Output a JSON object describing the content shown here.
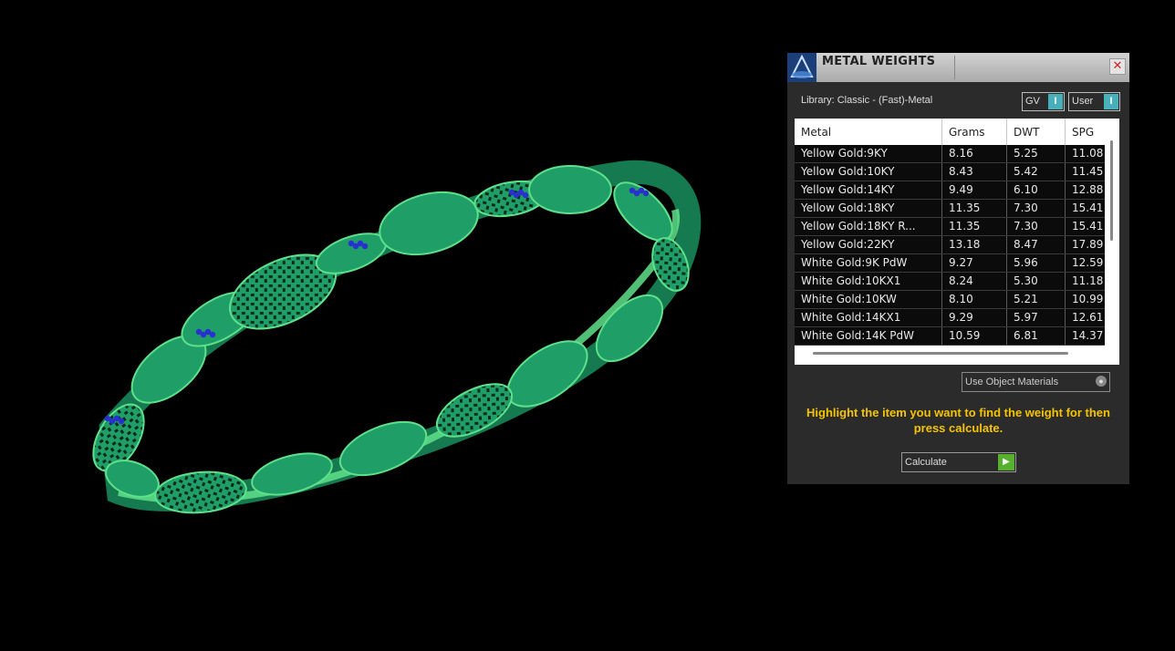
{
  "panel": {
    "title": "METAL WEIGHTS",
    "close_glyph": "✕",
    "logo_icon": "metal-weights-logo-icon",
    "library_label": "Library: Classic - (Fast)-Metal",
    "toggle_gv": {
      "label": "GV",
      "glyph": "I"
    },
    "toggle_user": {
      "label": "User",
      "glyph": "I"
    },
    "columns": [
      "Metal",
      "Grams",
      "DWT",
      "SPG"
    ],
    "rows": [
      [
        "Yellow Gold:9KY",
        "8.16",
        "5.25",
        "11.08"
      ],
      [
        "Yellow Gold:10KY",
        "8.43",
        "5.42",
        "11.45"
      ],
      [
        "Yellow Gold:14KY",
        "9.49",
        "6.10",
        "12.88"
      ],
      [
        "Yellow Gold:18KY",
        "11.35",
        "7.30",
        "15.41"
      ],
      [
        "Yellow Gold:18KY R...",
        "11.35",
        "7.30",
        "15.41"
      ],
      [
        "Yellow Gold:22KY",
        "13.18",
        "8.47",
        "17.89"
      ],
      [
        "White Gold:9K PdW",
        "9.27",
        "5.96",
        "12.59"
      ],
      [
        "White Gold:10KX1",
        "8.24",
        "5.30",
        "11.18"
      ],
      [
        "White Gold:10KW",
        "8.10",
        "5.21",
        "10.99"
      ],
      [
        "White Gold:14KX1",
        "9.29",
        "5.97",
        "12.61"
      ],
      [
        "White Gold:14K PdW",
        "10.59",
        "6.81",
        "14.37"
      ]
    ],
    "material_select": "Use Object Materials",
    "hint": "Highlight the item you want to find the weight for then press calculate.",
    "calculate_label": "Calculate",
    "calculate_icon": "play-arrow-icon"
  },
  "viewport": {
    "object": "bracelet-render",
    "colors": {
      "metal": "#1f9e68",
      "highlight": "#5fe08a",
      "gems": "#2a2fd0"
    }
  }
}
